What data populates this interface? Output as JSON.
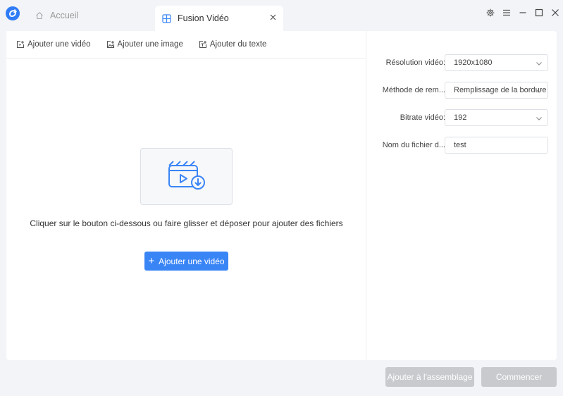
{
  "titlebar": {
    "tabs": [
      {
        "label": "Accueil",
        "active": false
      },
      {
        "label": "Fusion Vidéo",
        "active": true
      }
    ]
  },
  "toolbar": {
    "add_video": "Ajouter une vidéo",
    "add_image": "Ajouter une image",
    "add_text": "Ajouter du texte"
  },
  "dropzone": {
    "hint": "Cliquer sur le bouton ci-dessous ou faire glisser et déposer pour ajouter des fichiers",
    "add_button": "Ajouter une vidéo"
  },
  "settings": [
    {
      "label": "Résolution vidéo:",
      "value": "1920x1080",
      "type": "select"
    },
    {
      "label": "Méthode de rem...",
      "value": "Remplissage de la bordure",
      "type": "select"
    },
    {
      "label": "Bitrate vidéo:",
      "value": "192",
      "type": "select"
    },
    {
      "label": "Nom du fichier d...",
      "value": "test",
      "type": "input"
    }
  ],
  "footer": {
    "add_to_merge": "Ajouter à l'assemblage",
    "start": "Commencer"
  },
  "colors": {
    "accent": "#3a85f6",
    "disabled": "#c8cacd",
    "background": "#f3f4f7"
  }
}
